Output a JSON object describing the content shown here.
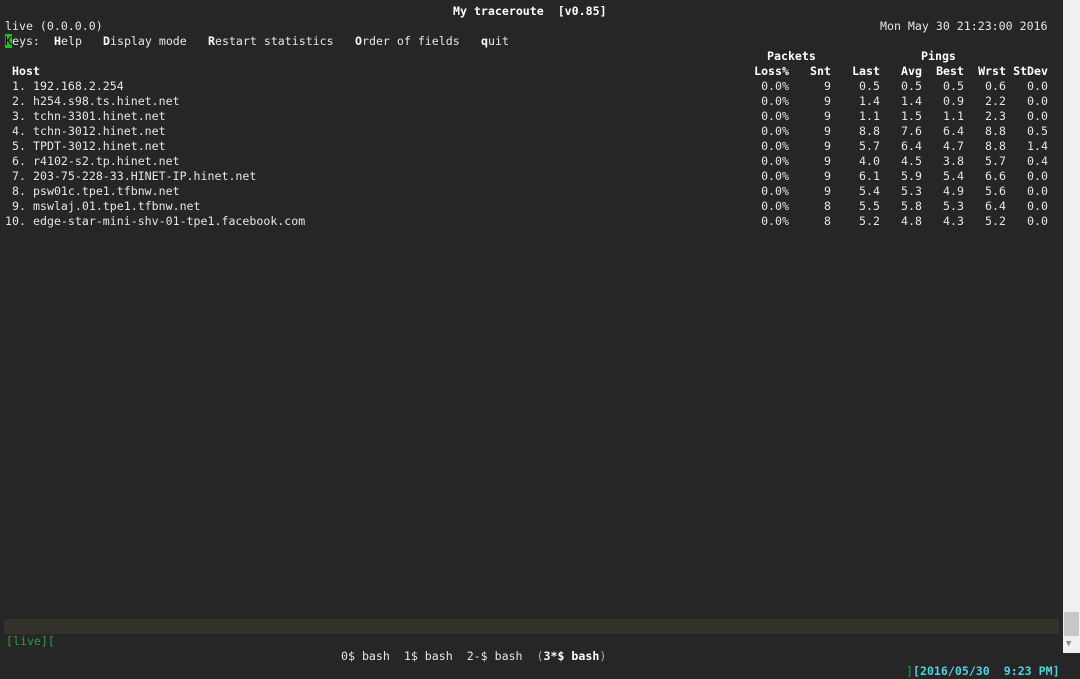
{
  "title": "My traceroute  [v0.85]",
  "source": "live (0.0.0.0)",
  "datetime": "Mon May 30 21:23:00 2016",
  "keys": {
    "label_first": "K",
    "label_rest": "eys:",
    "items": [
      {
        "k": "H",
        "rest": "elp"
      },
      {
        "k": "D",
        "rest": "isplay mode"
      },
      {
        "k": "R",
        "rest": "estart statistics"
      },
      {
        "k": "O",
        "rest": "rder of fields"
      },
      {
        "k": "q",
        "rest": "uit"
      }
    ]
  },
  "headers": {
    "packets": "Packets",
    "pings": "Pings",
    "host": "Host",
    "cols": [
      "Loss%",
      "Snt",
      "Last",
      "Avg",
      "Best",
      "Wrst",
      "StDev"
    ]
  },
  "rows": [
    [
      "1.",
      "192.168.2.254",
      "0.0%",
      "9",
      "0.5",
      "0.5",
      "0.5",
      "0.6",
      "0.0"
    ],
    [
      "2.",
      "h254.s98.ts.hinet.net",
      "0.0%",
      "9",
      "1.4",
      "1.4",
      "0.9",
      "2.2",
      "0.0"
    ],
    [
      "3.",
      "tchn-3301.hinet.net",
      "0.0%",
      "9",
      "1.1",
      "1.5",
      "1.1",
      "2.3",
      "0.0"
    ],
    [
      "4.",
      "tchn-3012.hinet.net",
      "0.0%",
      "9",
      "8.8",
      "7.6",
      "6.4",
      "8.8",
      "0.5"
    ],
    [
      "5.",
      "TPDT-3012.hinet.net",
      "0.0%",
      "9",
      "5.7",
      "6.4",
      "4.7",
      "8.8",
      "1.4"
    ],
    [
      "6.",
      "r4102-s2.tp.hinet.net",
      "0.0%",
      "9",
      "4.0",
      "4.5",
      "3.8",
      "5.7",
      "0.4"
    ],
    [
      "7.",
      "203-75-228-33.HINET-IP.hinet.net",
      "0.0%",
      "9",
      "6.1",
      "5.9",
      "5.4",
      "6.6",
      "0.0"
    ],
    [
      "8.",
      "psw01c.tpe1.tfbnw.net",
      "0.0%",
      "9",
      "5.4",
      "5.3",
      "4.9",
      "5.6",
      "0.0"
    ],
    [
      "9.",
      "mswlaj.01.tpe1.tfbnw.net",
      "0.0%",
      "8",
      "5.5",
      "5.8",
      "5.3",
      "6.4",
      "0.0"
    ],
    [
      "10.",
      "edge-star-mini-shv-01-tpe1.facebook.com",
      "0.0%",
      "8",
      "5.2",
      "4.8",
      "4.3",
      "5.2",
      "0.0"
    ]
  ],
  "status": {
    "session": "live",
    "windows": [
      "0$ bash",
      "1$ bash",
      "2-$ bash"
    ],
    "active": "3*$ bash",
    "clock": "2016/05/30  9:23 PM"
  },
  "colors": {
    "green": "#2e9e3e",
    "cyan": "#4fd3e0",
    "orange": "#e0a070"
  }
}
